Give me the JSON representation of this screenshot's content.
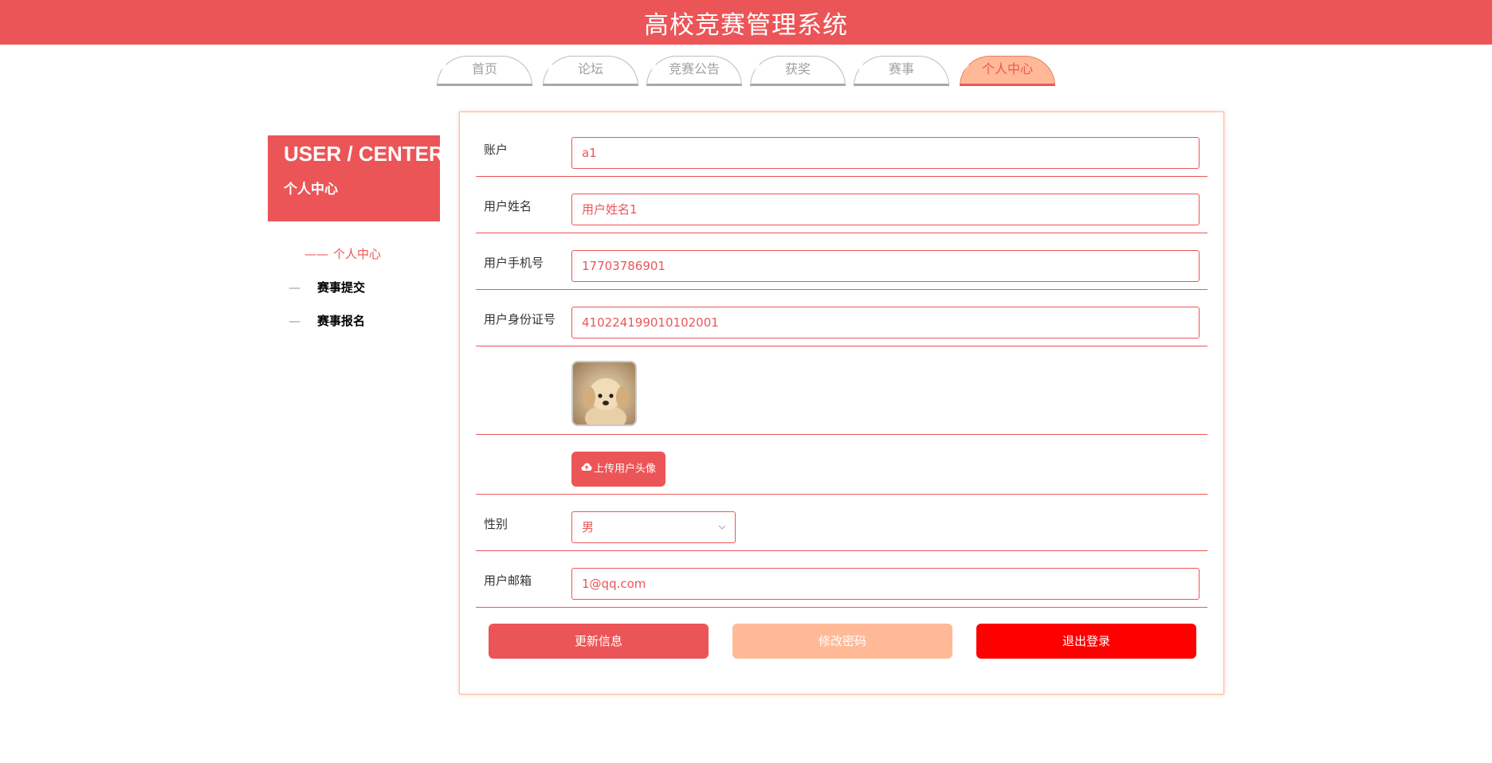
{
  "header": {
    "title": "高校竞赛管理系统"
  },
  "nav": {
    "tabs": [
      {
        "label": "首页",
        "active": false
      },
      {
        "label": "论坛",
        "active": false
      },
      {
        "label": "竞赛公告",
        "active": false
      },
      {
        "label": "获奖",
        "active": false
      },
      {
        "label": "赛事",
        "active": false
      },
      {
        "label": "个人中心",
        "active": true
      }
    ]
  },
  "sidebar": {
    "title_en": "USER / CENTER",
    "title_cn": "个人中心",
    "items": [
      {
        "dash": "——",
        "label": "个人中心",
        "active": true
      },
      {
        "dash": "—",
        "label": "赛事提交",
        "active": false
      },
      {
        "dash": "—",
        "label": "赛事报名",
        "active": false
      }
    ]
  },
  "form": {
    "account": {
      "label": "账户",
      "value": "a1"
    },
    "name": {
      "label": "用户姓名",
      "value": "用户姓名1"
    },
    "phone": {
      "label": "用户手机号",
      "value": "17703786901"
    },
    "idcard": {
      "label": "用户身份证号",
      "value": "410224199010102001"
    },
    "upload_label": "上传用户头像",
    "gender": {
      "label": "性别",
      "value": "男"
    },
    "email": {
      "label": "用户邮箱",
      "value": "1@qq.com"
    }
  },
  "actions": {
    "update": "更新信息",
    "change_password": "修改密码",
    "logout": "退出登录"
  },
  "colors": {
    "primary": "#ec5557",
    "accent": "#ffb997",
    "danger": "#ff0000"
  }
}
